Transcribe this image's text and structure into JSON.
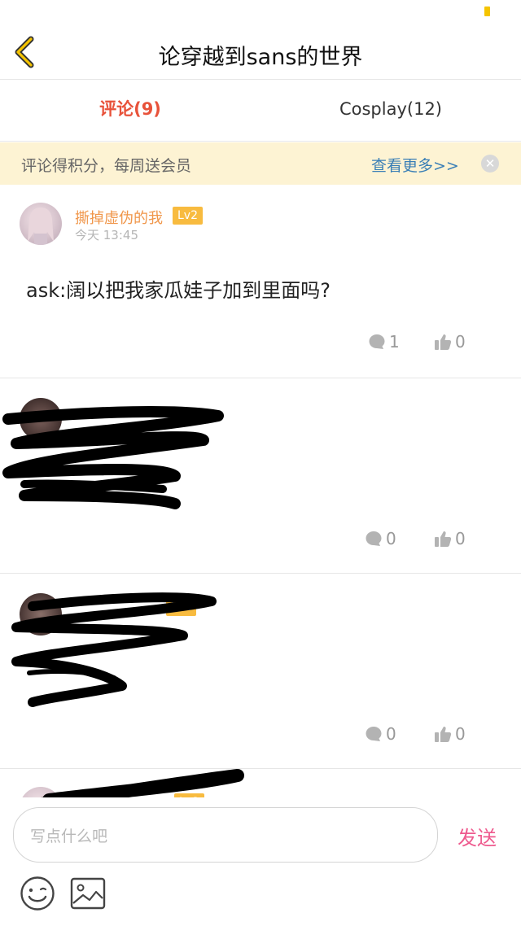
{
  "header": {
    "title": "论穿越到sans的世界",
    "back_icon": "chevron-left-icon",
    "accent_color": "#f5c400"
  },
  "tabs": [
    {
      "label": "评论(9)",
      "active": true
    },
    {
      "label": "Cosplay(12)",
      "active": false
    }
  ],
  "banner": {
    "text": "评论得积分，每周送会员",
    "more_link": "查看更多>>",
    "close_icon": "close-icon"
  },
  "comments": [
    {
      "username": "撕掉虚伪的我",
      "level": "Lv2",
      "time": "今天 13:45",
      "text": "ask:阔以把我家瓜娃子加到里面吗?",
      "reply_count": "1",
      "like_count": "0"
    },
    {
      "username": "",
      "level": "",
      "time": "",
      "text": "",
      "reply_count": "0",
      "like_count": "0"
    },
    {
      "username": "",
      "level": "Lv2",
      "time": "",
      "text": "",
      "reply_count": "0",
      "like_count": "0"
    },
    {
      "username": "",
      "level": "Lv2",
      "time": "",
      "text": "",
      "reply_count": "",
      "like_count": ""
    }
  ],
  "composer": {
    "placeholder": "写点什么吧",
    "send_label": "发送",
    "emoji_icon": "emoji-icon",
    "image_icon": "image-icon"
  }
}
